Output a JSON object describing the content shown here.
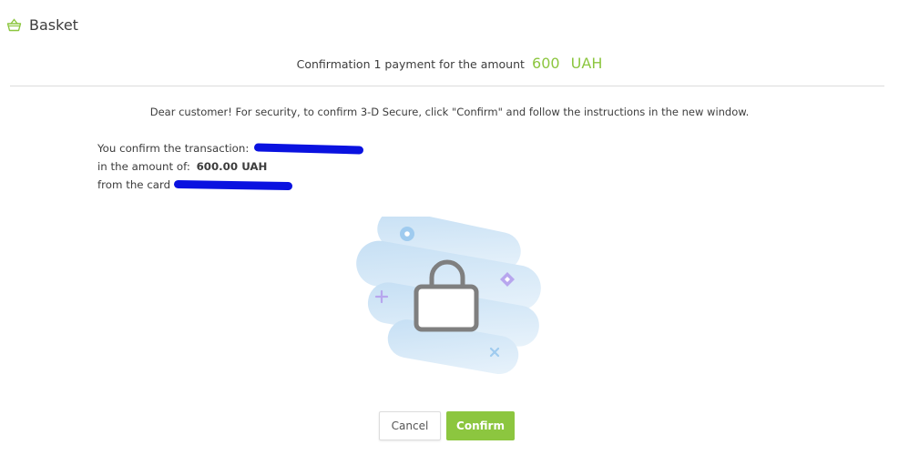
{
  "header": {
    "title": "Basket"
  },
  "confirmation": {
    "text": "Confirmation 1 payment for the amount",
    "amount": "600",
    "currency": "UAH"
  },
  "notice": "Dear customer! For security, to confirm 3-D Secure, click \"Confirm\" and follow the instructions in the new window.",
  "details": {
    "transaction_label": "You confirm the transaction:",
    "amount_label": "in the amount of:",
    "amount_value": "600.00  UAH",
    "card_label": "from the card"
  },
  "buttons": {
    "cancel": "Cancel",
    "confirm": "Confirm"
  },
  "colors": {
    "accent": "#8cc63f",
    "redaction": "#0a12e0",
    "divider": "#dcdcdc"
  }
}
